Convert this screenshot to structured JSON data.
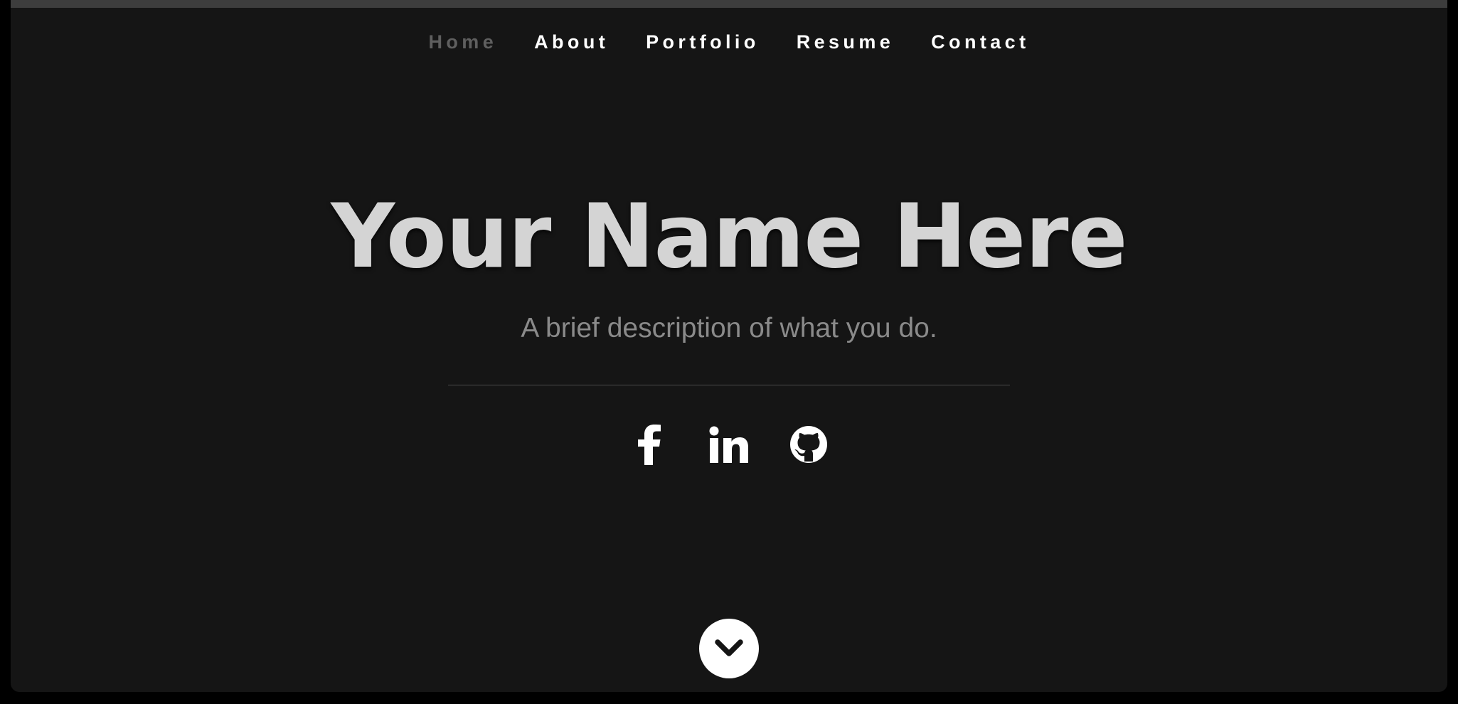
{
  "nav": {
    "items": [
      {
        "label": "Home",
        "active": true
      },
      {
        "label": "About",
        "active": false
      },
      {
        "label": "Portfolio",
        "active": false
      },
      {
        "label": "Resume",
        "active": false
      },
      {
        "label": "Contact",
        "active": false
      }
    ]
  },
  "hero": {
    "title": "Your Name Here",
    "subtitle": "A brief description of what you do."
  },
  "social": [
    {
      "icon": "facebook-icon"
    },
    {
      "icon": "linkedin-icon"
    },
    {
      "icon": "github-icon"
    }
  ],
  "scroll_button": {
    "icon": "chevron-down-icon"
  },
  "colors": {
    "background": "#151515",
    "nav_active": "#5f5f5f",
    "title": "#d4d4d4",
    "subtitle": "#8a8a8a"
  }
}
